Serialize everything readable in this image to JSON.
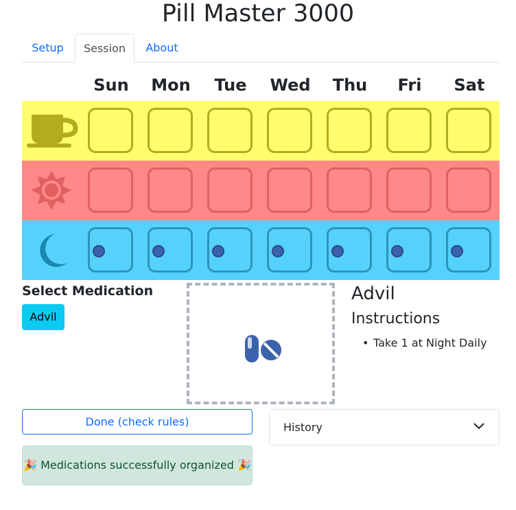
{
  "app": {
    "title": "Pill Master 3000"
  },
  "tabs": [
    {
      "label": "Setup",
      "active": false
    },
    {
      "label": "Session",
      "active": true
    },
    {
      "label": "About",
      "active": false
    }
  ],
  "days": [
    "Sun",
    "Mon",
    "Tue",
    "Wed",
    "Thu",
    "Fri",
    "Sat"
  ],
  "rows": [
    {
      "period": "morning",
      "icon": "coffee-cup-icon",
      "color": "#fefe6e",
      "pills": [
        0,
        0,
        0,
        0,
        0,
        0,
        0
      ]
    },
    {
      "period": "noon",
      "icon": "sun-icon",
      "color": "#ff8888",
      "pills": [
        0,
        0,
        0,
        0,
        0,
        0,
        0
      ]
    },
    {
      "period": "night",
      "icon": "moon-icon",
      "color": "#55d2fb",
      "pills": [
        1,
        1,
        1,
        1,
        1,
        1,
        1
      ]
    }
  ],
  "medication": {
    "select_label": "Select Medication",
    "options": [
      "Advil"
    ],
    "selected": "Advil",
    "dropzone_icon": "pills-icon"
  },
  "details": {
    "name": "Advil",
    "instructions_heading": "Instructions",
    "instructions": [
      "Take 1 at Night Daily"
    ]
  },
  "actions": {
    "done_label": "Done (check rules)",
    "history_label": "History"
  },
  "status": {
    "message": "🎉 Medications successfully organized 🎉",
    "color": "#d1e7dd"
  }
}
